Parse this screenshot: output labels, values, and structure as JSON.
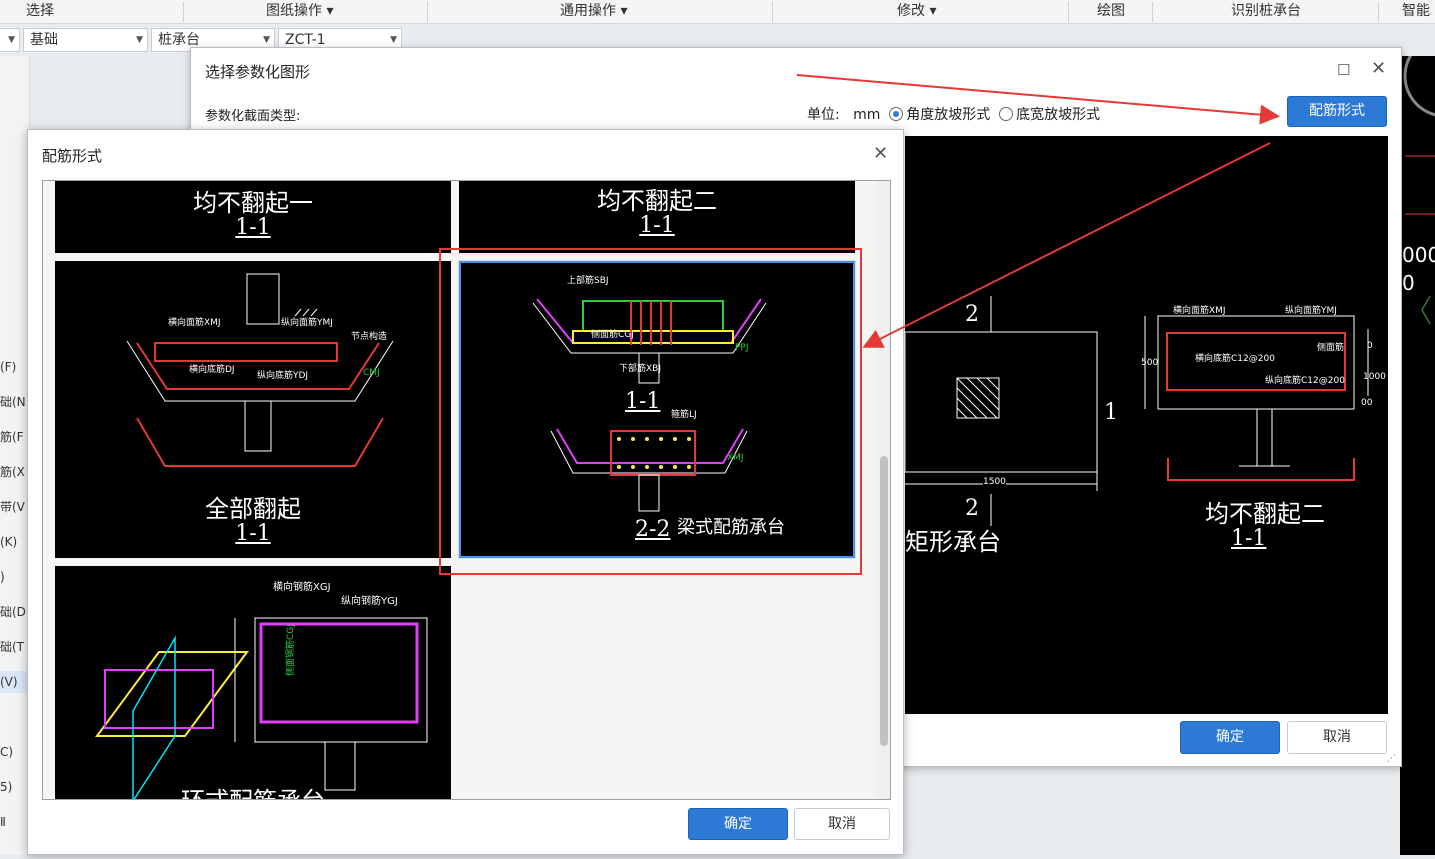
{
  "toolbar": {
    "items": [
      "选择",
      "图纸操作",
      "通用操作",
      "修改",
      "绘图",
      "识别桩承台",
      "智能"
    ]
  },
  "combos": [
    "",
    "基础",
    "桩承台",
    "ZCT-1"
  ],
  "left_panel": {
    "items": [
      "(F)",
      "础(N",
      "筋(F",
      "筋(X",
      "带(V",
      "(K)",
      ")",
      "础(D",
      "础(T",
      "(V)",
      "C)",
      "5)",
      "Ⅱ"
    ]
  },
  "dialog_param": {
    "title": "选择参数化图形",
    "section_label": "参数化截面类型:",
    "unit_label": "单位:",
    "unit_value": "mm",
    "radio_angle": "角度放坡形式",
    "radio_width": "底宽放坡形式",
    "rebar_button": "配筋形式",
    "ok": "确定",
    "cancel": "取消",
    "preview": {
      "shape_name": "矩形承台",
      "section_marks": [
        "2",
        "1",
        "2"
      ],
      "dim": "1500",
      "right_title": "均不翻起二",
      "right_sub": "1-1",
      "labels": [
        "横向面筋XMJ",
        "纵向面筋YMJ",
        "横向底筋C12@200",
        "纵向底筋C12@200",
        "侧面筋",
        "500",
        "1000",
        "0",
        "00"
      ]
    }
  },
  "dialog_rebar": {
    "title": "配筋形式",
    "ok": "确定",
    "cancel": "取消",
    "cells": [
      {
        "title": "均不翻起一",
        "sub": "1-1"
      },
      {
        "title": "均不翻起二",
        "sub": "1-1"
      },
      {
        "title": "全部翻起",
        "sub": "1-1",
        "labels": [
          "横向面筋XMJ",
          "纵向面筋YMJ",
          "横向底筋DJ",
          "纵向底筋YDJ",
          "CMJ",
          "节点构造"
        ]
      },
      {
        "title": "梁式配筋承台",
        "sub1": "1-1",
        "sub2": "2-2",
        "labels": [
          "上部筋SBJ",
          "侧面筋CGJ",
          "下部筋XBJ",
          "箍筋LJ",
          "PPJ",
          "XMJ"
        ]
      },
      {
        "title": "环式配筋承台",
        "labels": [
          "横向钢筋XGJ",
          "纵向钢筋YGJ",
          "侧面钢筋CGJ"
        ]
      }
    ]
  },
  "colors": {
    "accent": "#2d79d6",
    "highlight": "#e53935",
    "cad_bg": "#000000"
  }
}
